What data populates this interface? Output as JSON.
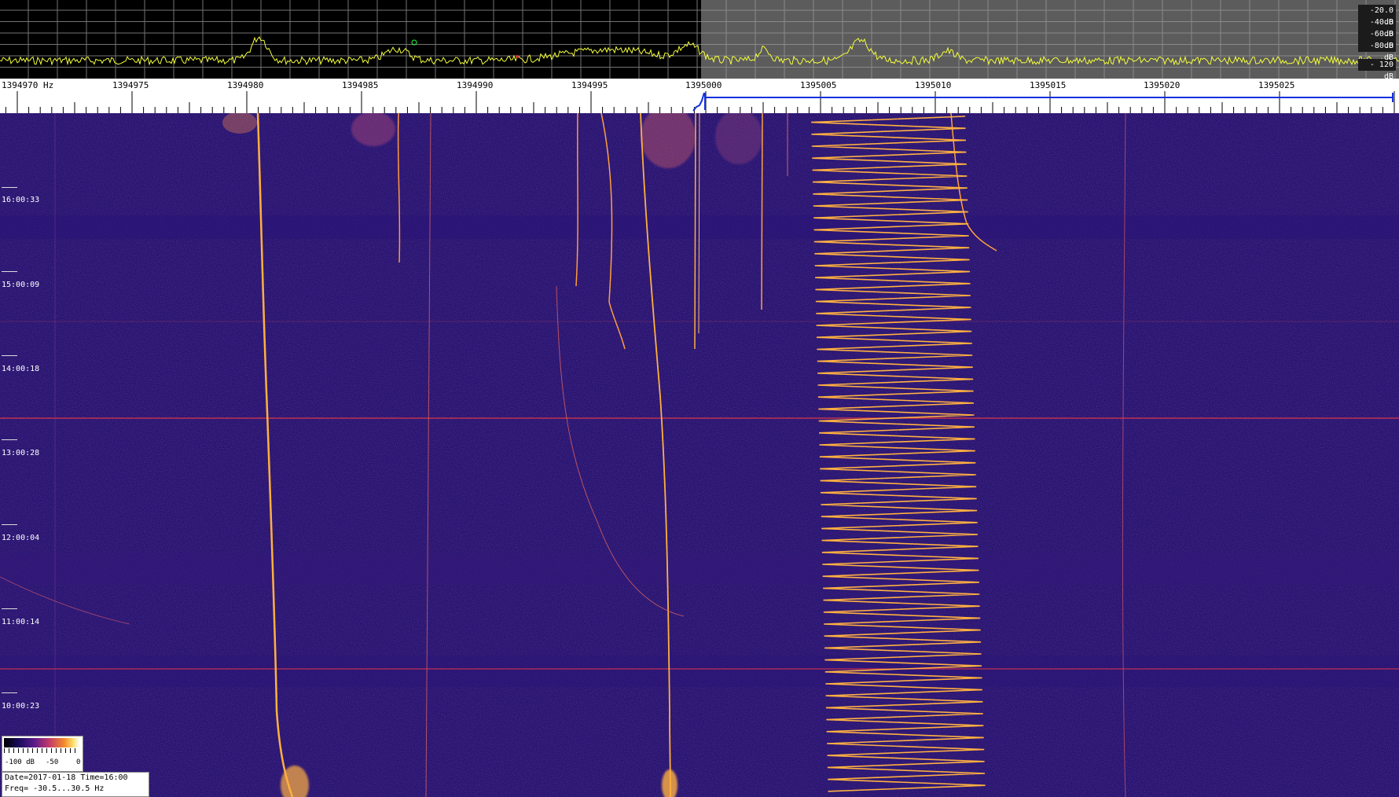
{
  "spectrum": {
    "db_scale": [
      "-20.0 dB",
      "-40.0 dB",
      "-60.0 dB",
      "-80.0 dB",
      "- 120 dB"
    ]
  },
  "freq_axis": {
    "labels": [
      "1394970 Hz",
      "1394975",
      "1394980",
      "1394985",
      "1394990",
      "1394995",
      "1395000",
      "1395005",
      "1395010",
      "1395015",
      "1395020",
      "1395025"
    ]
  },
  "waterfall": {
    "time_labels": [
      "16:00:33",
      "15:00:09",
      "14:00:18",
      "13:00:28",
      "12:00:04",
      "11:00:14",
      "10:00:23"
    ]
  },
  "colorbar": {
    "labels": [
      "-100 dB",
      "-50",
      "0"
    ]
  },
  "info": {
    "date_time": "Date=2017-01-18 Time=16:00",
    "freq": "Freq= -30.5...30.5 Hz"
  },
  "colors": {
    "waterfall_bg": "#221067",
    "trace": "#f4ff3a",
    "signal": "#ffb040",
    "marker_blue": "#1030e0",
    "hline": "#c03050"
  }
}
